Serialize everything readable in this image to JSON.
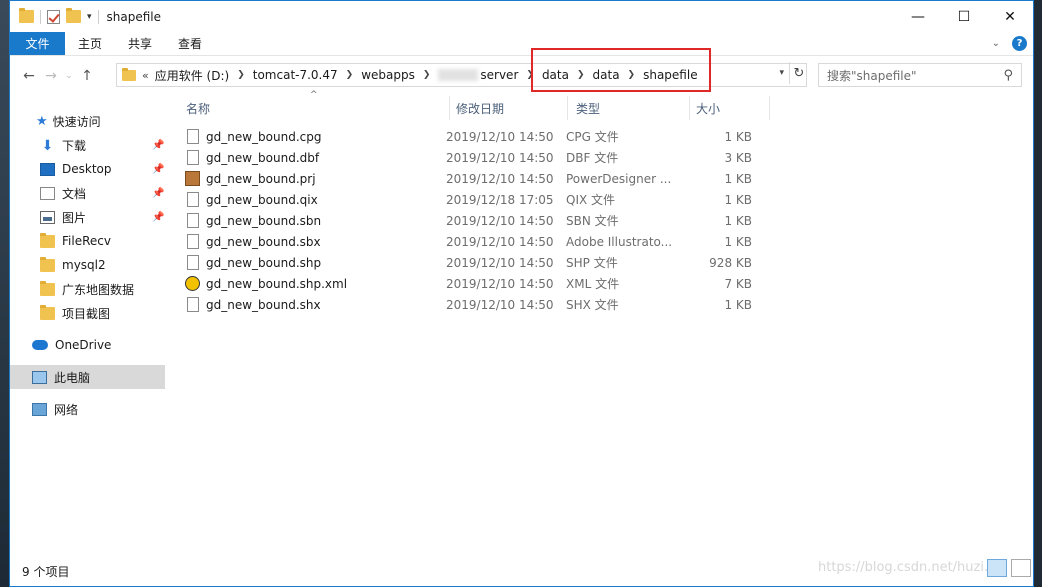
{
  "title": "shapefile",
  "ribbon": {
    "tabs": [
      "文件",
      "主页",
      "共享",
      "查看"
    ]
  },
  "address": {
    "crumbs": [
      "应用软件 (D:)",
      "tomcat-7.0.47",
      "webapps",
      "server",
      "data",
      "data",
      "shapefile"
    ],
    "overflow": "«"
  },
  "search": {
    "placeholder": "搜索\"shapefile\""
  },
  "sidebar": {
    "quick_access": "快速访问",
    "items": [
      {
        "label": "下载",
        "pinned": true
      },
      {
        "label": "Desktop",
        "pinned": true
      },
      {
        "label": "文档",
        "pinned": true
      },
      {
        "label": "图片",
        "pinned": true
      },
      {
        "label": "FileRecv",
        "pinned": false
      },
      {
        "label": "mysql2",
        "pinned": false
      },
      {
        "label": "广东地图数据",
        "pinned": false
      },
      {
        "label": "项目截图",
        "pinned": false
      }
    ],
    "onedrive": "OneDrive",
    "this_pc": "此电脑",
    "network": "网络"
  },
  "columns": {
    "name": "名称",
    "date": "修改日期",
    "type": "类型",
    "size": "大小"
  },
  "files": [
    {
      "name": "gd_new_bound.cpg",
      "date": "2019/12/10 14:50",
      "type": "CPG 文件",
      "size": "1 KB",
      "icon": "file-icon"
    },
    {
      "name": "gd_new_bound.dbf",
      "date": "2019/12/10 14:50",
      "type": "DBF 文件",
      "size": "3 KB",
      "icon": "file-icon"
    },
    {
      "name": "gd_new_bound.prj",
      "date": "2019/12/10 14:50",
      "type": "PowerDesigner ...",
      "size": "1 KB",
      "icon": "powerdesigner-icon"
    },
    {
      "name": "gd_new_bound.qix",
      "date": "2019/12/18 17:05",
      "type": "QIX 文件",
      "size": "1 KB",
      "icon": "file-icon"
    },
    {
      "name": "gd_new_bound.sbn",
      "date": "2019/12/10 14:50",
      "type": "SBN 文件",
      "size": "1 KB",
      "icon": "file-icon"
    },
    {
      "name": "gd_new_bound.sbx",
      "date": "2019/12/10 14:50",
      "type": "Adobe Illustrato...",
      "size": "1 KB",
      "icon": "file-icon"
    },
    {
      "name": "gd_new_bound.shp",
      "date": "2019/12/10 14:50",
      "type": "SHP 文件",
      "size": "928 KB",
      "icon": "file-icon"
    },
    {
      "name": "gd_new_bound.shp.xml",
      "date": "2019/12/10 14:50",
      "type": "XML 文件",
      "size": "7 KB",
      "icon": "xml-icon"
    },
    {
      "name": "gd_new_bound.shx",
      "date": "2019/12/10 14:50",
      "type": "SHX 文件",
      "size": "1 KB",
      "icon": "file-icon"
    }
  ],
  "status": {
    "count": "9 个项目"
  },
  "watermark": "https://blog.csdn.net/huzi...",
  "colors": {
    "accent": "#1979ca",
    "highlight": "#e02828"
  }
}
